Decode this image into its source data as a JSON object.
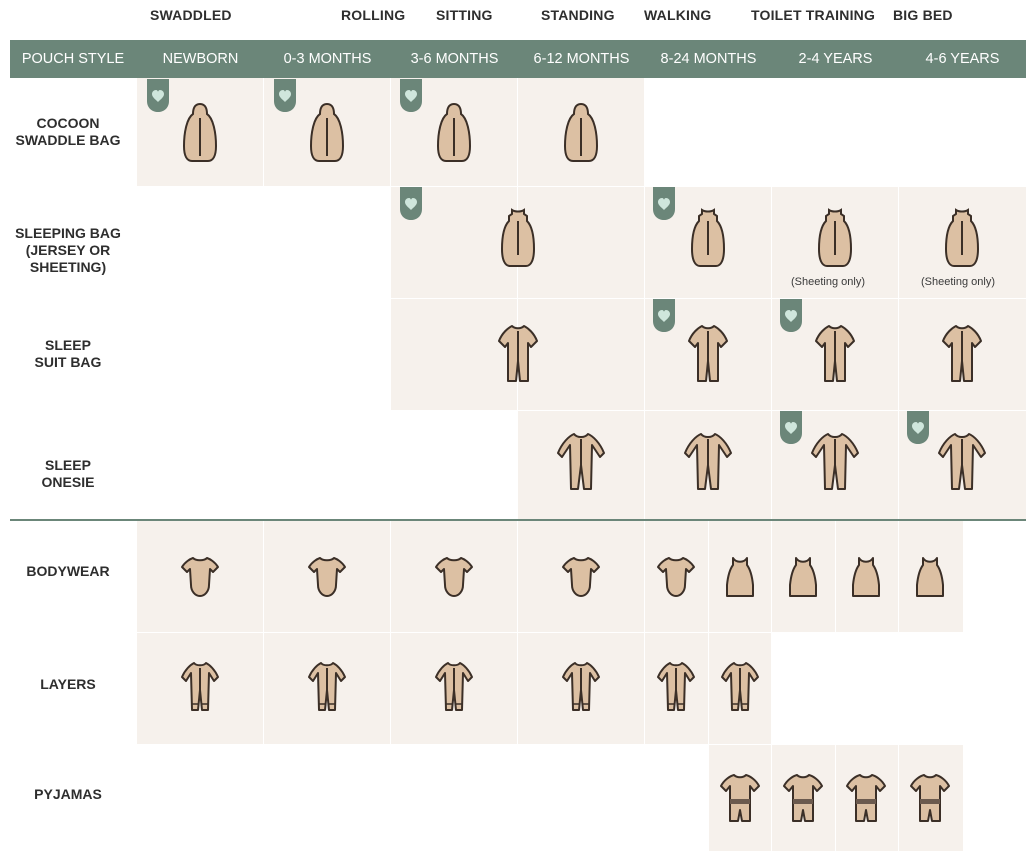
{
  "milestones": [
    {
      "id": "swaddled",
      "label": "SWADDLED"
    },
    {
      "id": "rolling",
      "label": "ROLLING"
    },
    {
      "id": "sitting",
      "label": "SITTING"
    },
    {
      "id": "standing",
      "label": "STANDING"
    },
    {
      "id": "walking",
      "label": "WALKING"
    },
    {
      "id": "toilet",
      "label": "TOILET TRAINING"
    },
    {
      "id": "bigbed",
      "label": "BIG BED"
    }
  ],
  "header": {
    "corner": "POUCH STYLE",
    "ages": [
      "NEWBORN",
      "0-3 MONTHS",
      "3-6 MONTHS",
      "6-12 MONTHS",
      "8-24 MONTHS",
      "2-4 YEARS",
      "4-6 YEARS"
    ]
  },
  "rows": [
    {
      "id": "cocoon",
      "label_lines": [
        "COCOON",
        "SWADDLE BAG"
      ]
    },
    {
      "id": "sleepingbag",
      "label_lines": [
        "SLEEPING BAG",
        "(JERSEY OR",
        "SHEETING)"
      ]
    },
    {
      "id": "sleepsuit",
      "label_lines": [
        "SLEEP",
        "SUIT BAG"
      ]
    },
    {
      "id": "onesie",
      "label_lines": [
        "SLEEP",
        "ONESIE"
      ]
    },
    {
      "id": "bodywear",
      "label_lines": [
        "BODYWEAR"
      ]
    },
    {
      "id": "layers",
      "label_lines": [
        "LAYERS"
      ]
    },
    {
      "id": "pyjamas",
      "label_lines": [
        "PYJAMAS"
      ]
    }
  ],
  "notes": {
    "sheeting_only_1": "(Sheeting only)",
    "sheeting_only_2": "(Sheeting only)"
  },
  "colors": {
    "header_green": "#6b8679",
    "tag_green": "#6b8679",
    "heart": "#cfe6dc",
    "garment_fill": "#dcc0a3",
    "garment_stroke": "#3b2f27",
    "shade": "#f6f1ec"
  },
  "icons": {
    "cocoon": "cocoon-swaddle-icon",
    "sleepingbag": "sleeping-bag-icon",
    "sleepsuit": "sleep-suit-bag-icon",
    "onesie": "sleep-onesie-icon",
    "bodysuit": "bodysuit-icon",
    "singlet": "singlet-icon",
    "layers": "layers-icon",
    "pyjamas": "pyjamas-icon",
    "tag": "heart-tag-icon"
  }
}
